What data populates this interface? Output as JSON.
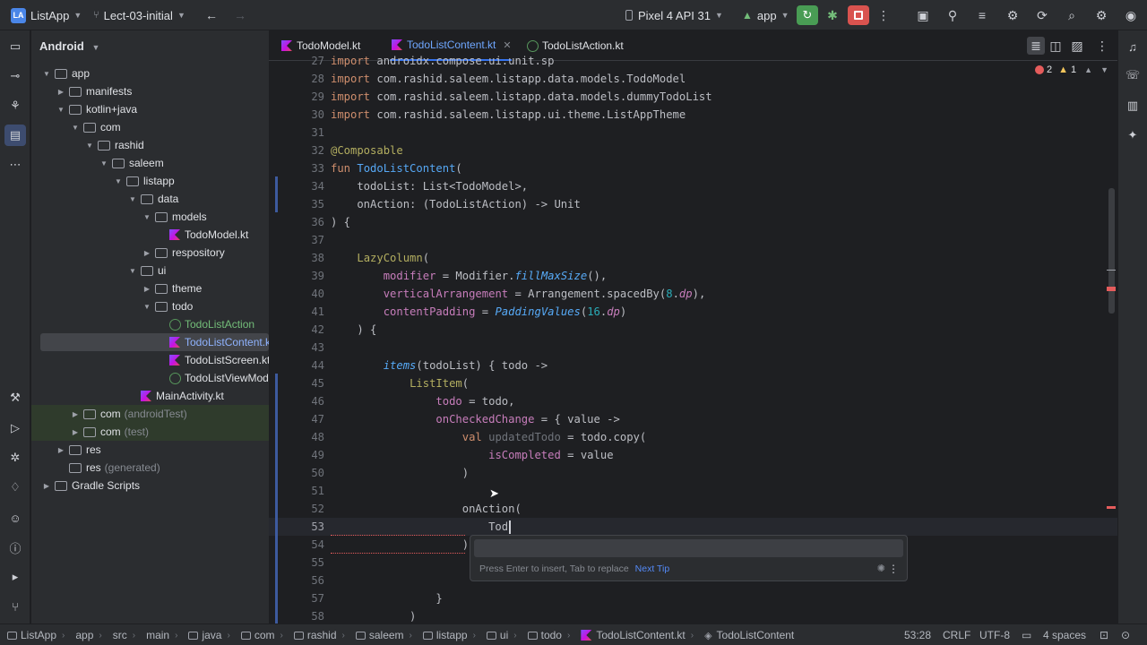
{
  "toolbar": {
    "project_badge": "LA",
    "project_name": "ListApp",
    "branch": "Lect-03-initial",
    "device": "Pixel 4 API 31",
    "run_config": "app",
    "colors": {
      "run_green": "#499c54",
      "stop_red": "#d9534f"
    }
  },
  "project_panel": {
    "title": "Android",
    "tree": [
      {
        "label": "app",
        "depth": 0,
        "expanded": true,
        "icon": "module-folder-icon"
      },
      {
        "label": "manifests",
        "depth": 1,
        "expanded": false,
        "icon": "folder-icon"
      },
      {
        "label": "kotlin+java",
        "depth": 1,
        "expanded": true,
        "icon": "folder-icon"
      },
      {
        "label": "com",
        "depth": 2,
        "expanded": true,
        "icon": "package-icon"
      },
      {
        "label": "rashid",
        "depth": 3,
        "expanded": true,
        "icon": "package-icon"
      },
      {
        "label": "saleem",
        "depth": 4,
        "expanded": true,
        "icon": "package-icon"
      },
      {
        "label": "listapp",
        "depth": 5,
        "expanded": true,
        "icon": "package-icon"
      },
      {
        "label": "data",
        "depth": 6,
        "expanded": true,
        "icon": "package-icon"
      },
      {
        "label": "models",
        "depth": 7,
        "expanded": true,
        "icon": "package-icon"
      },
      {
        "label": "TodoModel.kt",
        "depth": 8,
        "icon": "kotlin-file-icon"
      },
      {
        "label": "respository",
        "depth": 7,
        "expanded": false,
        "icon": "package-icon"
      },
      {
        "label": "ui",
        "depth": 6,
        "expanded": true,
        "icon": "package-icon"
      },
      {
        "label": "theme",
        "depth": 7,
        "expanded": false,
        "icon": "package-icon"
      },
      {
        "label": "todo",
        "depth": 7,
        "expanded": true,
        "icon": "package-icon"
      },
      {
        "label": "TodoListAction",
        "depth": 8,
        "icon": "kotlin-class-icon",
        "color": "green"
      },
      {
        "label": "TodoListContent.kt",
        "depth": 8,
        "icon": "kotlin-file-icon",
        "selected": true
      },
      {
        "label": "TodoListScreen.kt",
        "depth": 8,
        "icon": "kotlin-file-icon"
      },
      {
        "label": "TodoListViewModel",
        "depth": 8,
        "icon": "kotlin-class-icon"
      },
      {
        "label": "MainActivity.kt",
        "depth": 6,
        "icon": "kotlin-file-icon"
      },
      {
        "label": "com",
        "suffix": "(androidTest)",
        "depth": 2,
        "expanded": false,
        "icon": "package-icon",
        "generated": true
      },
      {
        "label": "com",
        "suffix": "(test)",
        "depth": 2,
        "expanded": false,
        "icon": "package-icon",
        "generated": true
      },
      {
        "label": "res",
        "depth": 1,
        "expanded": false,
        "icon": "folder-icon"
      },
      {
        "label": "res",
        "suffix": "(generated)",
        "depth": 1,
        "icon": "folder-icon"
      },
      {
        "label": "Gradle Scripts",
        "depth": 0,
        "expanded": false,
        "icon": "gradle-icon"
      }
    ]
  },
  "tabs": [
    {
      "label": "TodoModel.kt",
      "active": false
    },
    {
      "label": "TodoListContent.kt",
      "active": true,
      "close": "✕"
    },
    {
      "label": "TodoListAction.kt",
      "active": false
    }
  ],
  "inspections": {
    "errors": "2",
    "warnings": "1"
  },
  "code_lines": [
    {
      "n": "27",
      "html": "<span class='kw'>import</span> androidx.compose.ui.unit.sp"
    },
    {
      "n": "28",
      "html": "<span class='kw'>import</span> com.rashid.saleem.listapp.data.models.TodoModel"
    },
    {
      "n": "29",
      "html": "<span class='kw'>import</span> com.rashid.saleem.listapp.data.models.dummyTodoList"
    },
    {
      "n": "30",
      "html": "<span class='kw'>import</span> com.rashid.saleem.listapp.ui.theme.ListAppTheme"
    },
    {
      "n": "31",
      "html": ""
    },
    {
      "n": "32",
      "html": "<span class='an'>@Composable</span>"
    },
    {
      "n": "33",
      "html": "<span class='kw'>fun</span> <span class='fn'>TodoListContent</span>("
    },
    {
      "n": "34",
      "html": "    todoList: List&lt;TodoModel&gt;,"
    },
    {
      "n": "35",
      "html": "    onAction: (TodoListAction) -&gt; Unit"
    },
    {
      "n": "36",
      "html": ") {"
    },
    {
      "n": "37",
      "html": ""
    },
    {
      "n": "38",
      "html": "    <span class='an'>LazyColumn</span>("
    },
    {
      "n": "39",
      "html": "        <span class='pr'>modifier</span> = Modifier.<span class='it'>fillMaxSize</span>(),"
    },
    {
      "n": "40",
      "html": "        <span class='pr'>verticalArrangement</span> = Arrangement.spacedBy(<span class='nm'>8</span>.<span class='vl'>dp</span>),"
    },
    {
      "n": "41",
      "html": "        <span class='pr'>contentPadding</span> = <span class='it'>PaddingValues</span>(<span class='nm'>16</span>.<span class='vl'>dp</span>)"
    },
    {
      "n": "42",
      "html": "    ) {"
    },
    {
      "n": "43",
      "html": ""
    },
    {
      "n": "44",
      "html": "        <span class='it'>items</span>(todoList) { todo -&gt;"
    },
    {
      "n": "45",
      "html": "            <span class='an'>ListItem</span>("
    },
    {
      "n": "46",
      "html": "                <span class='pr'>todo</span> = todo,"
    },
    {
      "n": "47",
      "html": "                <span class='pr'>onCheckedChange</span> = { value -&gt;"
    },
    {
      "n": "48",
      "html": "                    <span class='kw'>val</span> <span class='dim'>updatedTodo</span> = todo.copy("
    },
    {
      "n": "49",
      "html": "                        <span class='pr'>isCompleted</span> = value"
    },
    {
      "n": "50",
      "html": "                    )"
    },
    {
      "n": "51",
      "html": ""
    },
    {
      "n": "52",
      "html": "                    onAction("
    },
    {
      "n": "53",
      "html": "                        Tod"
    },
    {
      "n": "54",
      "html": "                    )"
    },
    {
      "n": "55",
      "html": ""
    },
    {
      "n": "56",
      "html": ""
    },
    {
      "n": "57",
      "html": "                }"
    },
    {
      "n": "58",
      "html": "            )"
    }
  ],
  "completion": {
    "hint": "Press Enter to insert, Tab to replace",
    "next_tip": "Next Tip"
  },
  "status_bar": {
    "breadcrumbs": [
      "ListApp",
      "app",
      "src",
      "main",
      "java",
      "com",
      "rashid",
      "saleem",
      "listapp",
      "ui",
      "todo",
      "TodoListContent.kt",
      "TodoListContent"
    ],
    "position": "53:28",
    "line_ending": "CRLF",
    "encoding": "UTF-8",
    "indent": "4 spaces"
  }
}
